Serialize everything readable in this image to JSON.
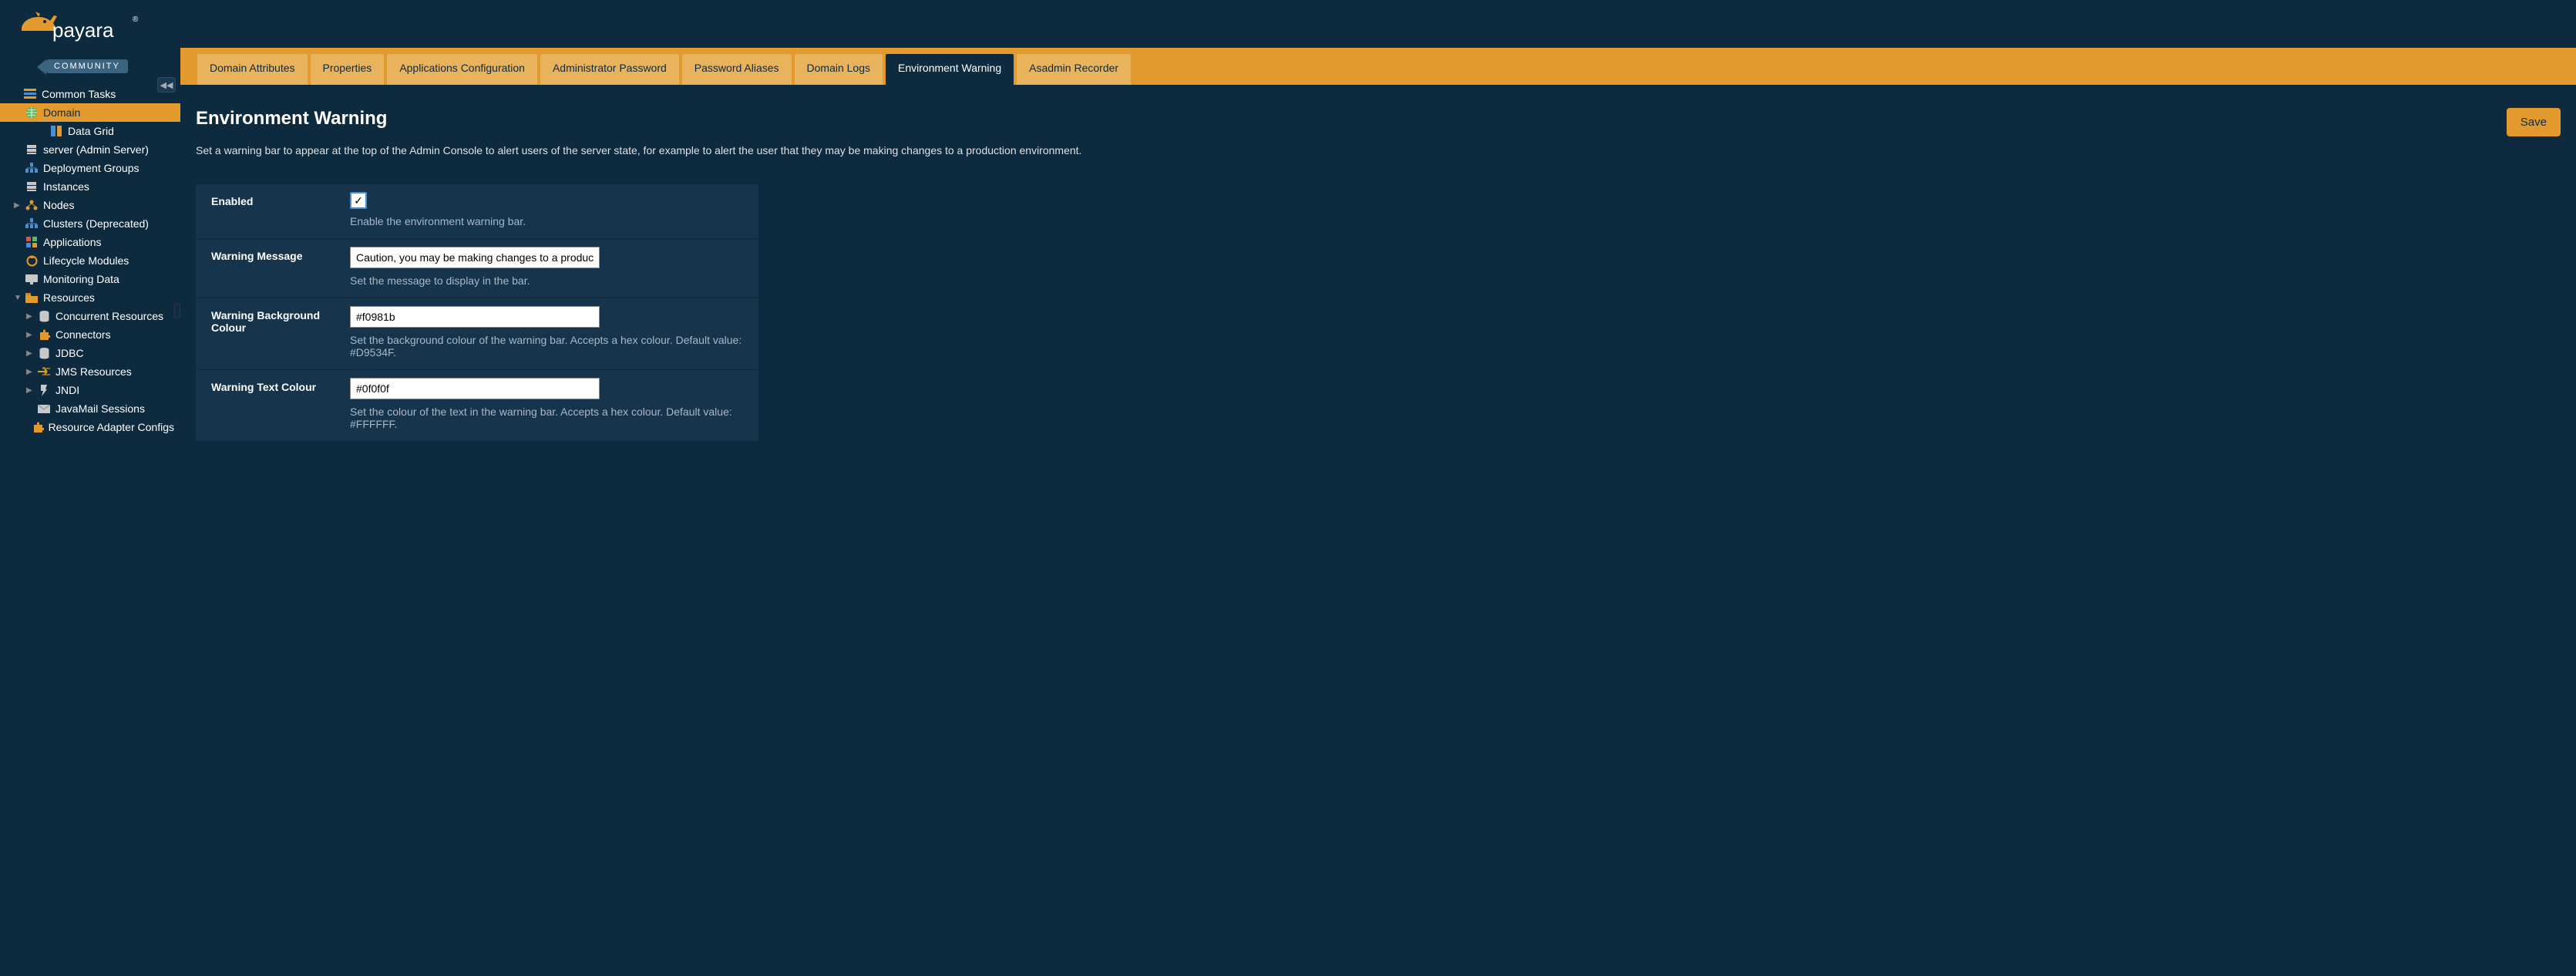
{
  "logo": {
    "brand": "payara",
    "edition": "COMMUNITY"
  },
  "sidebar": {
    "collapse_glyph": "◀◀",
    "root_label": "Common Tasks",
    "items": [
      {
        "label": "Domain",
        "selected": true,
        "indent": 1,
        "expand": "▼",
        "icon": "globe"
      },
      {
        "label": "Data Grid",
        "indent": 3,
        "icon": "grid"
      },
      {
        "label": "server (Admin Server)",
        "indent": 1,
        "icon": "server"
      },
      {
        "label": "Deployment Groups",
        "indent": 1,
        "icon": "cluster"
      },
      {
        "label": "Instances",
        "indent": 1,
        "icon": "server"
      },
      {
        "label": "Nodes",
        "indent": 1,
        "expand": "▶",
        "icon": "nodes"
      },
      {
        "label": "Clusters (Deprecated)",
        "indent": 1,
        "icon": "cluster"
      },
      {
        "label": "Applications",
        "indent": 1,
        "icon": "apps"
      },
      {
        "label": "Lifecycle Modules",
        "indent": 1,
        "icon": "lifecycle"
      },
      {
        "label": "Monitoring Data",
        "indent": 1,
        "icon": "monitor"
      },
      {
        "label": "Resources",
        "indent": 1,
        "expand": "▼",
        "icon": "folder"
      },
      {
        "label": "Concurrent Resources",
        "indent": 2,
        "expand": "▶",
        "icon": "db"
      },
      {
        "label": "Connectors",
        "indent": 2,
        "expand": "▶",
        "icon": "puzzle"
      },
      {
        "label": "JDBC",
        "indent": 2,
        "expand": "▶",
        "icon": "db"
      },
      {
        "label": "JMS Resources",
        "indent": 2,
        "expand": "▶",
        "icon": "jms"
      },
      {
        "label": "JNDI",
        "indent": 2,
        "expand": "▶",
        "icon": "jndi"
      },
      {
        "label": "JavaMail Sessions",
        "indent": 2,
        "icon": "mail"
      },
      {
        "label": "Resource Adapter Configs",
        "indent": 2,
        "icon": "puzzle"
      }
    ]
  },
  "tabs": [
    {
      "label": "Domain Attributes"
    },
    {
      "label": "Properties"
    },
    {
      "label": "Applications Configuration"
    },
    {
      "label": "Administrator Password"
    },
    {
      "label": "Password Aliases"
    },
    {
      "label": "Domain Logs"
    },
    {
      "label": "Environment Warning",
      "active": true
    },
    {
      "label": "Asadmin Recorder"
    }
  ],
  "page": {
    "title": "Environment Warning",
    "description": "Set a warning bar to appear at the top of the Admin Console to alert users of the server state, for example to alert the user that they may be making changes to a production environment.",
    "save_label": "Save"
  },
  "form": {
    "enabled": {
      "label": "Enabled",
      "checked": true,
      "help": "Enable the environment warning bar."
    },
    "message": {
      "label": "Warning Message",
      "value": "Caution, you may be making changes to a production server!",
      "help": "Set the message to display in the bar."
    },
    "bg_colour": {
      "label": "Warning Background Colour",
      "value": "#f0981b",
      "help": "Set the background colour of the warning bar. Accepts a hex colour. Default value: #D9534F."
    },
    "text_colour": {
      "label": "Warning Text Colour",
      "value": "#0f0f0f",
      "help": "Set the colour of the text in the warning bar. Accepts a hex colour. Default value: #FFFFFF."
    }
  }
}
